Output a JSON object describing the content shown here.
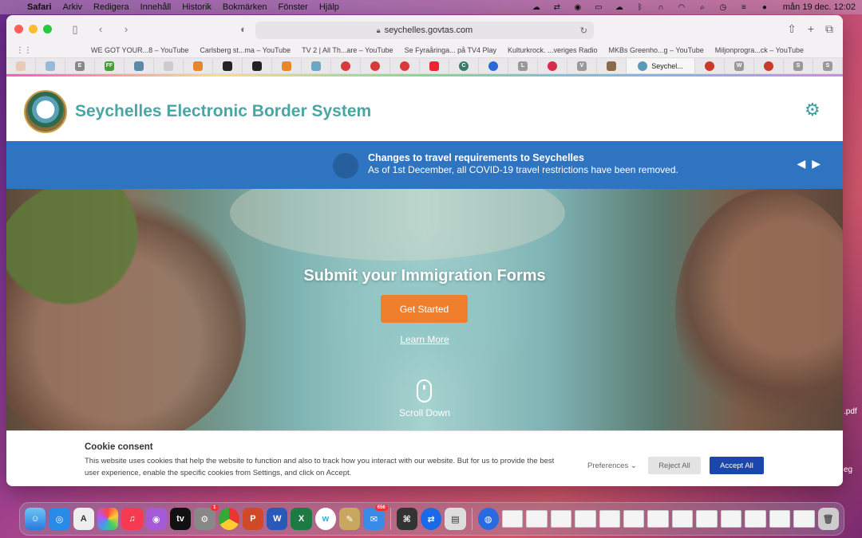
{
  "menubar": {
    "app": "Safari",
    "items": [
      "Arkiv",
      "Redigera",
      "Innehåll",
      "Historik",
      "Bokmärken",
      "Fönster",
      "Hjälp"
    ],
    "clock": "mån 19 dec.  12:02"
  },
  "browser": {
    "url": "seychelles.govtas.com",
    "favorites": [
      "WE GOT YOUR...8 – YouTube",
      "Carlsberg st...ma – YouTube",
      "TV 2 | All Th...are – YouTube",
      "Se Fyraåringa... på TV4 Play",
      "Kulturkrock. ...veriges Radio",
      "MKBs Greenho...g – YouTube",
      "Miljonprogra...ck – YouTube"
    ],
    "active_tab": "Seychel...",
    "tab_icons": [
      "E",
      "FF",
      "C",
      "L",
      "V",
      "W",
      "S",
      "S"
    ]
  },
  "site": {
    "title": "Seychelles Electronic Border System",
    "notice_title": "Changes to travel requirements to Seychelles",
    "notice_text": "As of 1st December, all COVID-19 travel restrictions have been removed.",
    "hero_title": "Submit your Immigration Forms",
    "cta": "Get Started",
    "learn_more": "Learn More",
    "scroll_down": "Scroll Down"
  },
  "cookie": {
    "title": "Cookie consent",
    "description": "This website uses cookies that help the website to function and also to track how you interact with our website. But for us to provide the best user experience, enable the specific cookies from Settings, and click on Accept.",
    "preferences": "Preferences",
    "reject": "Reject All",
    "accept": "Accept All"
  },
  "desktop": {
    "file1": ".pdf",
    "file2": "eg"
  },
  "dock": {
    "mail_badge": "656",
    "settings_badge": "1"
  },
  "colors": {
    "title_teal": "#4aa6a3",
    "notice_blue": "#2f74c0",
    "cta_orange": "#ef7f2c",
    "accept_blue": "#1b46ab"
  }
}
